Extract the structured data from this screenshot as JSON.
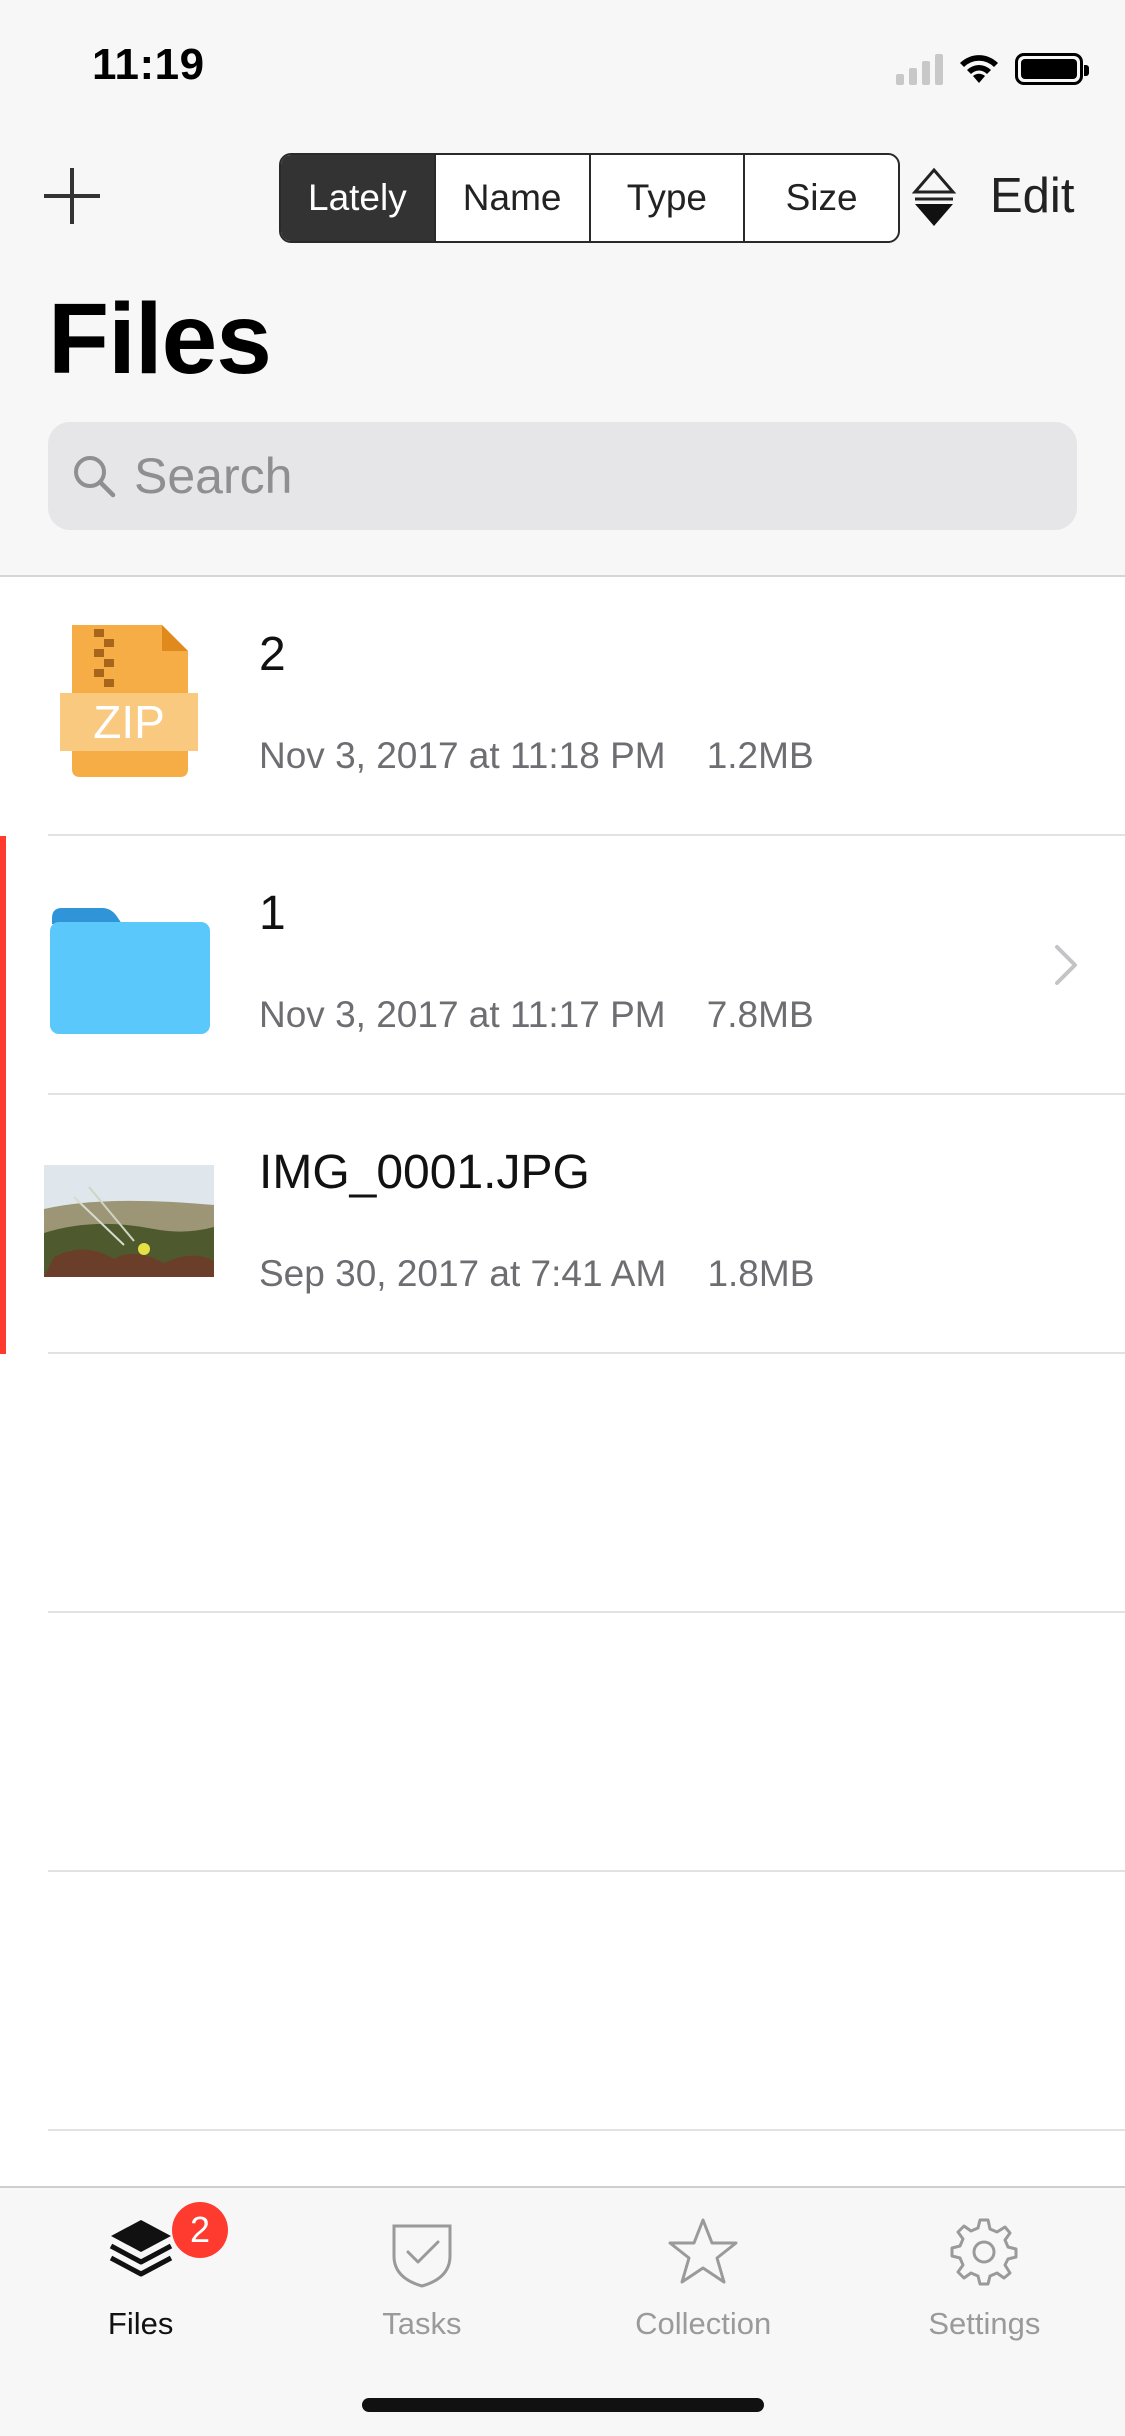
{
  "status_bar": {
    "time": "11:19"
  },
  "toolbar": {
    "sort_options": [
      "Lately",
      "Name",
      "Type",
      "Size"
    ],
    "active_sort": "Lately",
    "edit_label": "Edit"
  },
  "page": {
    "title": "Files"
  },
  "search": {
    "placeholder": "Search"
  },
  "files": [
    {
      "name": "2",
      "date": "Nov 3, 2017 at 11:18 PM",
      "size": "1.2MB",
      "kind": "zip",
      "icon_text": "ZIP"
    },
    {
      "name": "1",
      "date": "Nov 3, 2017 at 11:17 PM",
      "size": "7.8MB",
      "kind": "folder"
    },
    {
      "name": "IMG_0001.JPG",
      "date": "Sep 30, 2017 at 7:41 AM",
      "size": "1.8MB",
      "kind": "image"
    }
  ],
  "tab_bar": {
    "items": [
      {
        "label": "Files",
        "icon": "stack-icon",
        "badge": "2"
      },
      {
        "label": "Tasks",
        "icon": "tasks-check-icon"
      },
      {
        "label": "Collection",
        "icon": "star-icon"
      },
      {
        "label": "Settings",
        "icon": "gear-icon"
      }
    ]
  },
  "colors": {
    "accent_dark": "#333333",
    "badge_red": "#ff3b30",
    "zip_orange": "#f7ad45",
    "folder_blue": "#5ac8fa"
  }
}
